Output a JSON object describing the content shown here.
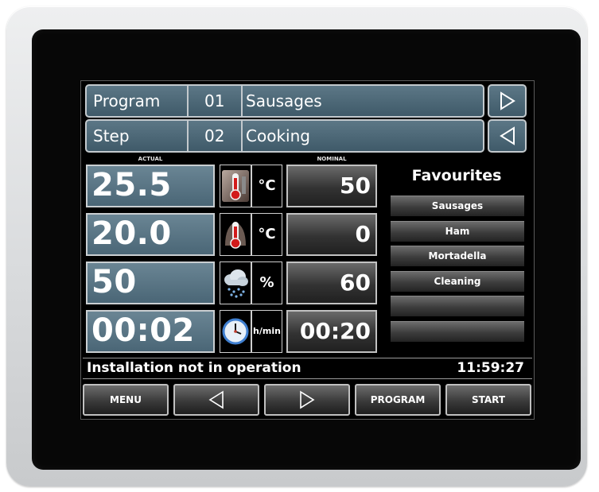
{
  "header": {
    "row1": {
      "label": "Program",
      "number": "01",
      "name": "Sausages"
    },
    "row2": {
      "label": "Step",
      "number": "02",
      "name": "Cooking"
    }
  },
  "columns": {
    "actual": "ACTUAL",
    "nominal": "NOMINAL"
  },
  "rows": [
    {
      "actual": "25.5",
      "unit": "°C",
      "icon": "thermometer-icon",
      "nominal": "50"
    },
    {
      "actual": "20.0",
      "unit": "°C",
      "icon": "core-temperature-icon",
      "nominal": "0"
    },
    {
      "actual": "50",
      "unit": "%",
      "icon": "humidity-cloud-icon",
      "nominal": "60"
    },
    {
      "actual": "00:02",
      "unit": "h/min",
      "icon": "clock-icon",
      "nominal": "00:20"
    }
  ],
  "favourites": {
    "title": "Favourites",
    "items": [
      "Sausages",
      "Ham",
      "Mortadella",
      "Cleaning",
      "",
      ""
    ]
  },
  "status": {
    "message": "Installation not in operation",
    "time": "11:59:27"
  },
  "buttons": {
    "menu": "MENU",
    "program": "PROGRAM",
    "start": "START"
  }
}
